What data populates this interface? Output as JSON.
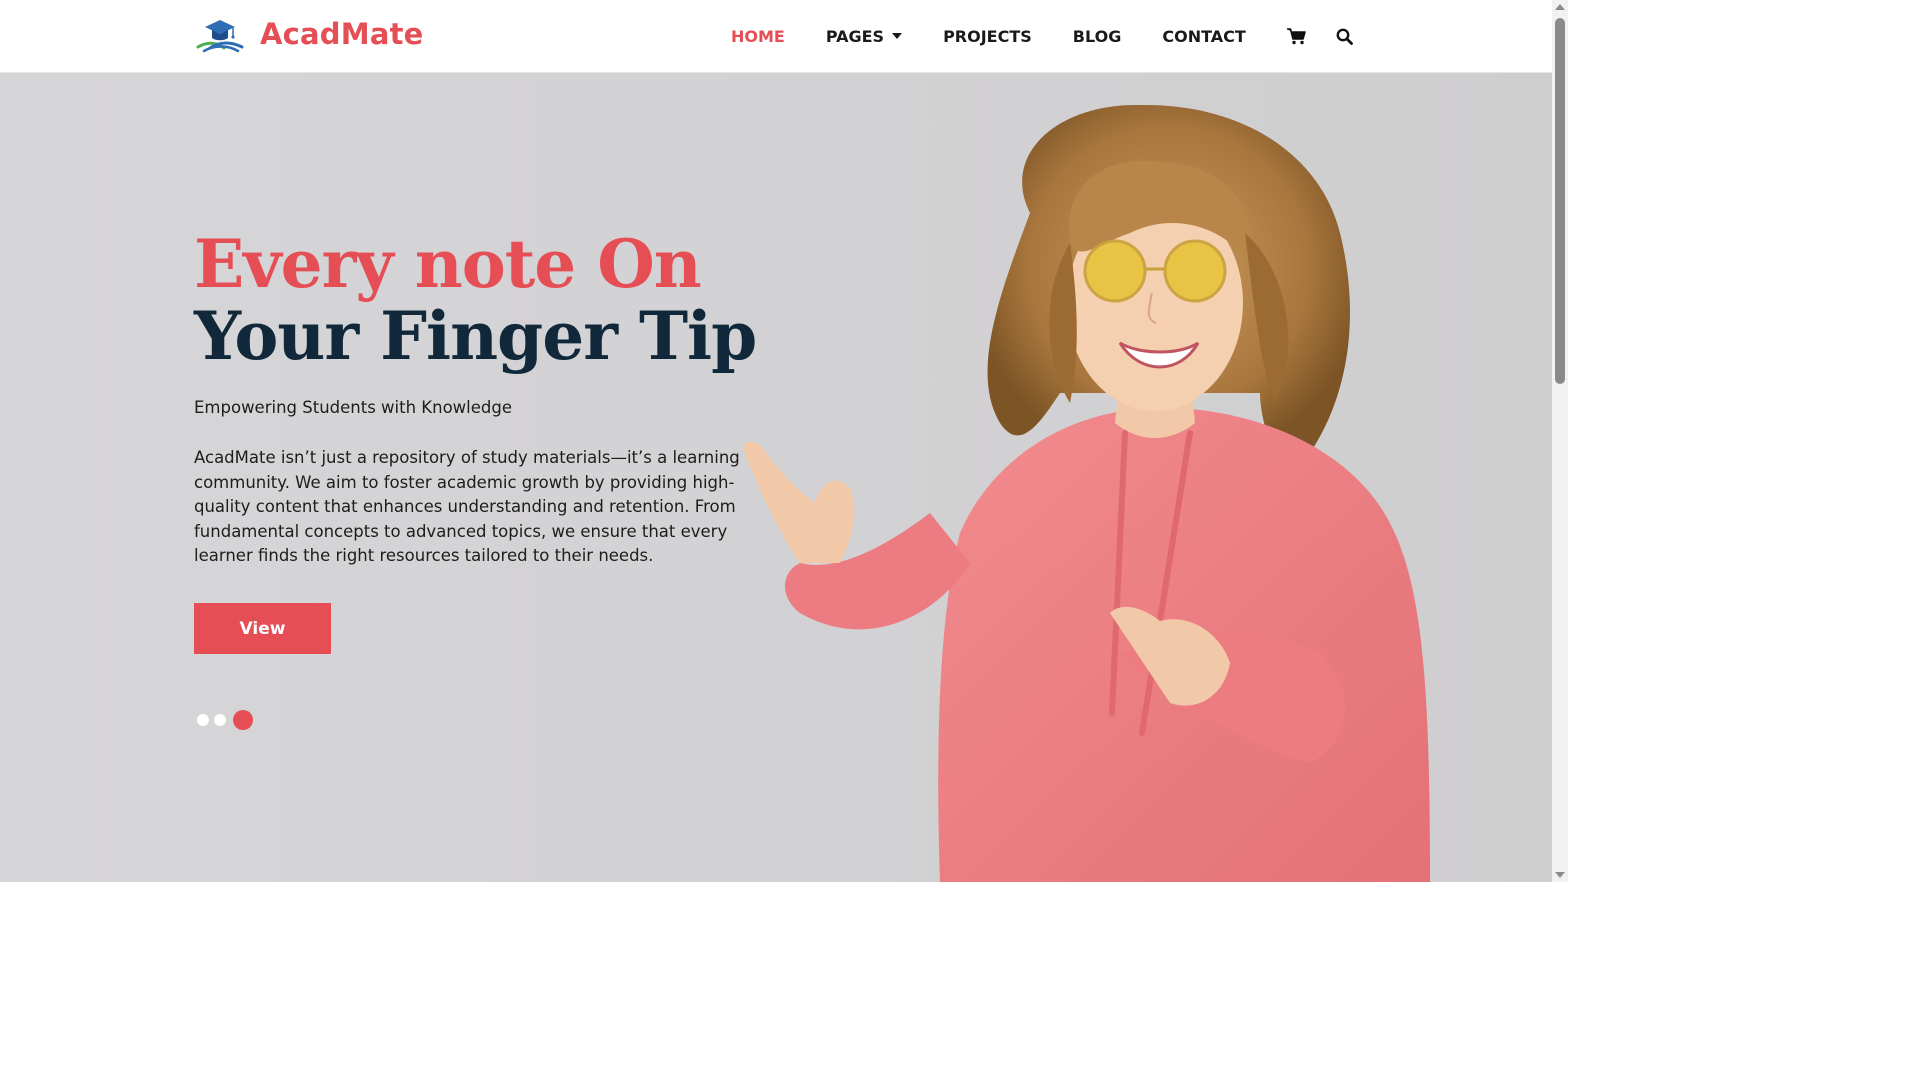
{
  "brand": {
    "name": "AcadMate",
    "accent_color": "#e54e55",
    "dark_color": "#10283a",
    "logo_icon": "graduation-cap-books-icon"
  },
  "nav": {
    "items": [
      {
        "label": "HOME",
        "active": true
      },
      {
        "label": "PAGES",
        "has_dropdown": true
      },
      {
        "label": "PROJECTS"
      },
      {
        "label": "BLOG"
      },
      {
        "label": "CONTACT"
      }
    ],
    "icons": [
      "cart-icon",
      "search-icon"
    ]
  },
  "hero": {
    "title_line1": "Every note On",
    "title_line2": "Your Finger Tip",
    "subtitle": "Empowering Students with Knowledge",
    "description": "AcadMate isn’t just a repository of study materials—it’s a learning community. We aim to foster academic growth by providing high-quality content that enhances understanding and retention. From fundamental concepts to advanced topics, we ensure that every learner finds the right resources tailored to their needs.",
    "button_label": "View",
    "slider": {
      "total": 3,
      "active": 3
    },
    "image": "woman-pink-hoodie-yellow-sunglasses-pointing"
  }
}
